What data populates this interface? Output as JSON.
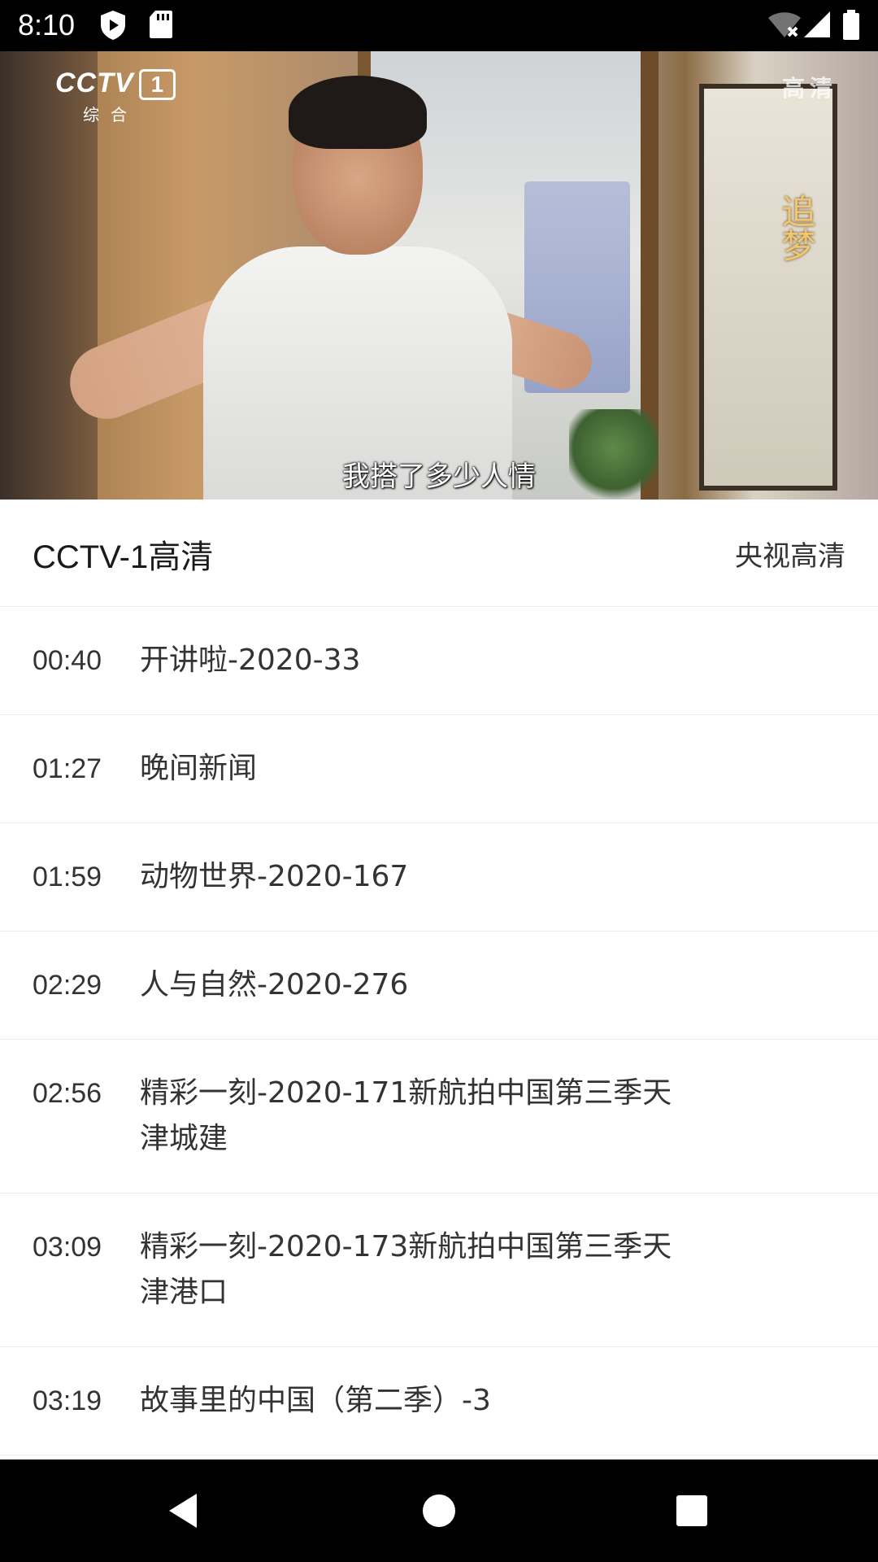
{
  "status_bar": {
    "time": "8:10",
    "icons": [
      "play-protect-icon",
      "sd-card-icon",
      "wifi-off-icon",
      "signal-icon",
      "battery-icon"
    ]
  },
  "video": {
    "logo_main": "CCTV",
    "logo_number": "1",
    "logo_sub": "综合",
    "quality_badge": "高清",
    "show_title": "追梦",
    "subtitle": "我搭了多少人情"
  },
  "channel": {
    "name": "CCTV-1高清",
    "source": "央视高清"
  },
  "programs": [
    {
      "time": "00:40",
      "title": "开讲啦-2020-33"
    },
    {
      "time": "01:27",
      "title": "晚间新闻"
    },
    {
      "time": "01:59",
      "title": "动物世界-2020-167"
    },
    {
      "time": "02:29",
      "title": "人与自然-2020-276"
    },
    {
      "time": "02:56",
      "title": "精彩一刻-2020-171新航拍中国第三季天津城建"
    },
    {
      "time": "03:09",
      "title": "精彩一刻-2020-173新航拍中国第三季天津港口"
    },
    {
      "time": "03:19",
      "title": "故事里的中国（第二季）-3"
    }
  ],
  "nav_bar": {
    "buttons": [
      "back-icon",
      "home-icon",
      "recents-icon"
    ]
  }
}
